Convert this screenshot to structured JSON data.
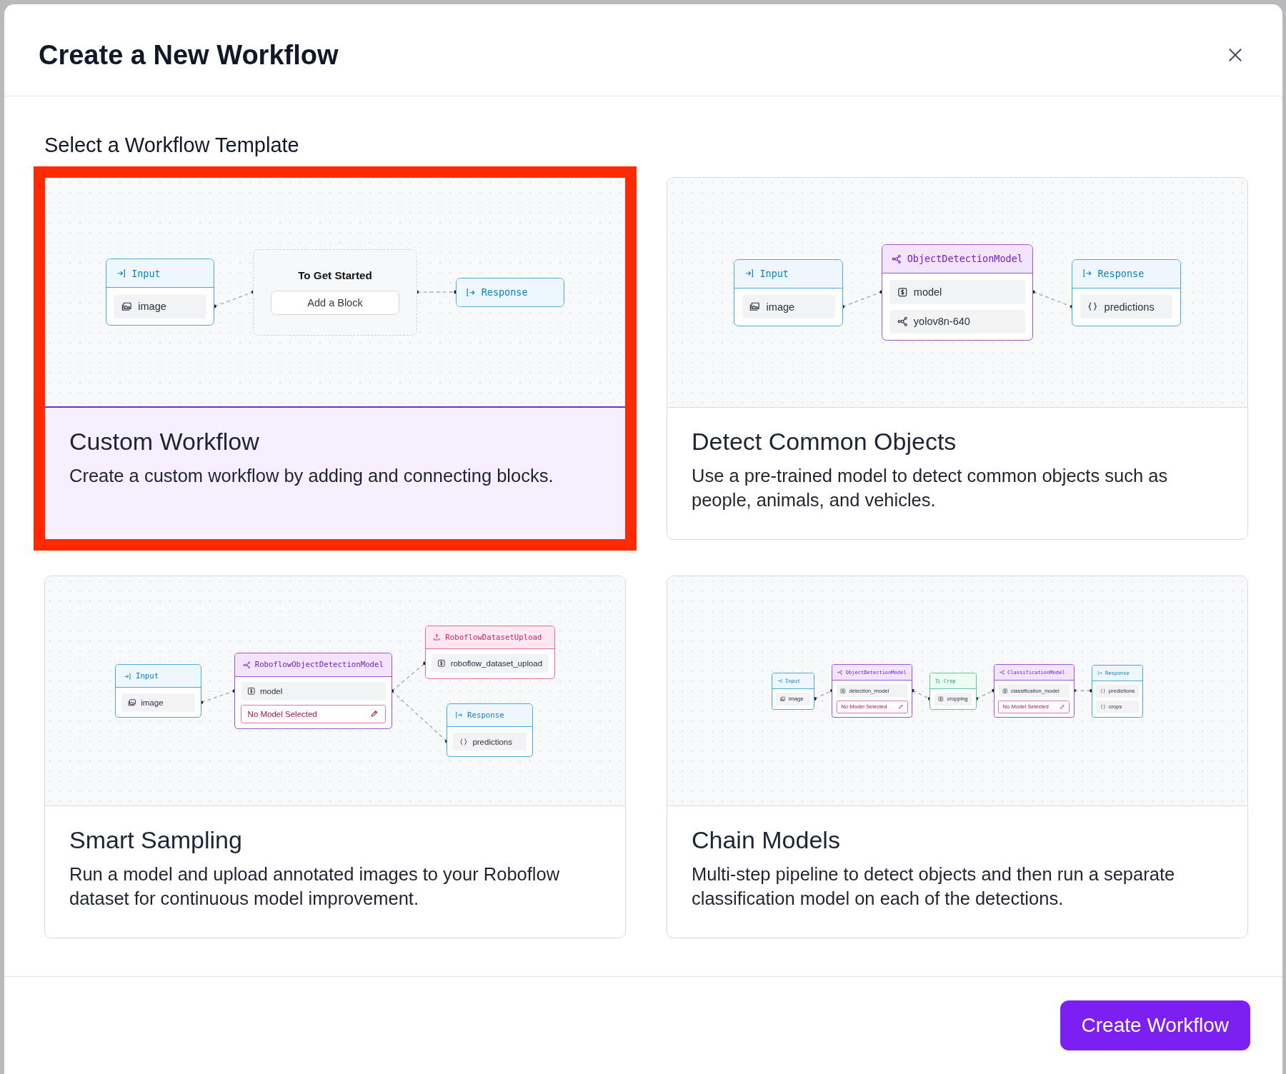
{
  "dialog": {
    "title": "Create a New Workflow"
  },
  "section_title": "Select a Workflow Template",
  "templates": [
    {
      "title": "Custom Workflow",
      "description": "Create a custom workflow by adding and connecting blocks.",
      "selected": true,
      "diagram": {
        "columns": [
          [
            {
              "kind": "input",
              "title": "Input",
              "fields": [
                {
                  "kind": "image",
                  "label": "image"
                }
              ]
            }
          ],
          [
            {
              "kind": "placeholder",
              "title": "To Get Started",
              "action": "Add a Block"
            }
          ],
          [
            {
              "kind": "response",
              "title": "Response"
            }
          ]
        ]
      }
    },
    {
      "title": "Detect Common Objects",
      "description": "Use a pre-trained model to detect common objects such as people, animals, and vehicles.",
      "selected": false,
      "diagram": {
        "columns": [
          [
            {
              "kind": "input",
              "title": "Input",
              "fields": [
                {
                  "kind": "image",
                  "label": "image"
                }
              ]
            }
          ],
          [
            {
              "kind": "model",
              "title": "ObjectDetectionModel",
              "fields": [
                {
                  "kind": "parameter",
                  "label": "model"
                },
                {
                  "kind": "model",
                  "label": "yolov8n-640"
                }
              ]
            }
          ],
          [
            {
              "kind": "response",
              "title": "Response",
              "fields": [
                {
                  "kind": "output",
                  "label": "predictions"
                }
              ]
            }
          ]
        ]
      }
    },
    {
      "title": "Smart Sampling",
      "description": "Run a model and upload annotated images to your Roboflow dataset for continuous model improvement.",
      "selected": false,
      "diagram": {
        "columns": [
          [
            {
              "kind": "input",
              "title": "Input",
              "fields": [
                {
                  "kind": "image",
                  "label": "image"
                }
              ]
            }
          ],
          [
            {
              "kind": "model",
              "title": "RoboflowObjectDetectionModel",
              "fields": [
                {
                  "kind": "parameter",
                  "label": "model"
                },
                {
                  "kind": "error",
                  "label": "No Model Selected"
                }
              ]
            }
          ],
          [
            {
              "kind": "upload",
              "title": "RoboflowDatasetUpload",
              "fields": [
                {
                  "kind": "parameter",
                  "label": "roboflow_dataset_upload"
                }
              ]
            },
            {
              "kind": "response",
              "title": "Response",
              "fields": [
                {
                  "kind": "output",
                  "label": "predictions"
                }
              ]
            }
          ]
        ]
      }
    },
    {
      "title": "Chain Models",
      "description": "Multi-step pipeline to detect objects and then run a separate classification model on each of the detections.",
      "selected": false,
      "diagram": {
        "columns": [
          [
            {
              "kind": "input",
              "title": "Input",
              "fields": [
                {
                  "kind": "image",
                  "label": "image"
                }
              ]
            }
          ],
          [
            {
              "kind": "model",
              "title": "ObjectDetectionModel",
              "fields": [
                {
                  "kind": "parameter",
                  "label": "detection_model"
                },
                {
                  "kind": "error",
                  "label": "No Model Selected"
                }
              ]
            }
          ],
          [
            {
              "kind": "crop",
              "title": "Crop",
              "fields": [
                {
                  "kind": "parameter",
                  "label": "cropping"
                }
              ]
            }
          ],
          [
            {
              "kind": "model",
              "title": "ClassificationModel",
              "fields": [
                {
                  "kind": "parameter",
                  "label": "classification_model"
                },
                {
                  "kind": "error",
                  "label": "No Model Selected"
                }
              ]
            }
          ],
          [
            {
              "kind": "response",
              "title": "Response",
              "fields": [
                {
                  "kind": "output",
                  "label": "predictions"
                },
                {
                  "kind": "output",
                  "label": "crops"
                }
              ]
            }
          ]
        ]
      }
    }
  ],
  "create_button": "Create Workflow"
}
